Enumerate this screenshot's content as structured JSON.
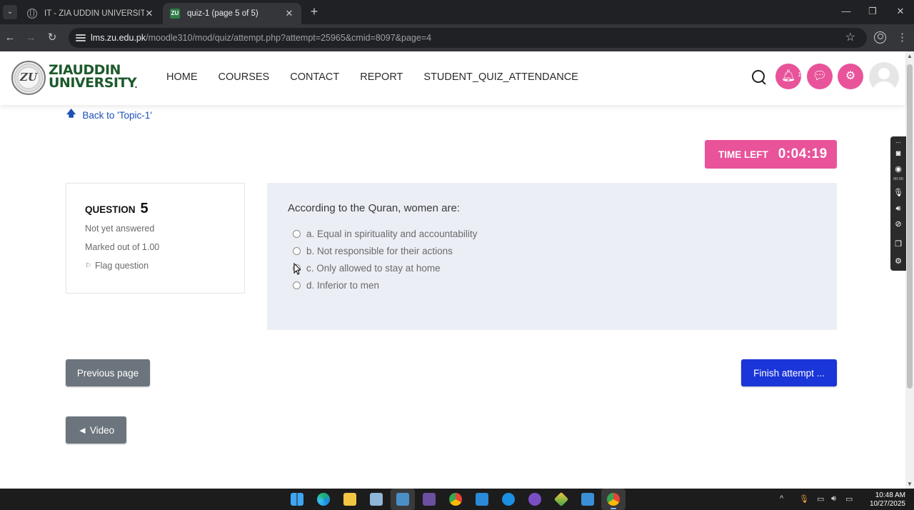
{
  "browser": {
    "tabs": [
      {
        "title": "IT - ZIA UDDIN UNIVERSITY",
        "favicon": "globe-icon",
        "active": false
      },
      {
        "title": "quiz-1 (page 5 of 5)",
        "favicon": "zu-favicon",
        "favicon_text": "ZU",
        "active": true
      }
    ],
    "url_host": "lms.zu.edu.pk",
    "url_path": "/moodle310/mod/quiz/attempt.php?attempt=25965&cmid=8097&page=4"
  },
  "header": {
    "logo_line1": "ZIAUDDIN",
    "logo_line2": "UNIVERSITY",
    "logo_dot": ".",
    "nav": [
      "HOME",
      "COURSES",
      "CONTACT",
      "REPORT",
      "STUDENT_QUIZ_ATTENDANCE"
    ],
    "notification_count": "1"
  },
  "page": {
    "back_link": "Back to 'Topic-1'",
    "timer_label": "TIME LEFT",
    "timer_value": "0:04:19"
  },
  "question": {
    "label": "QUESTION",
    "number": "5",
    "state": "Not yet answered",
    "grade": "Marked out of 1.00",
    "flag": "Flag question",
    "text": "According to the Quran, women are:",
    "answers": [
      "a. Equal in spirituality and accountability",
      "b. Not responsible for their actions",
      "c. Only allowed to stay at home",
      "d. Inferior to men"
    ]
  },
  "buttons": {
    "previous": "Previous page",
    "finish": "Finish attempt ...",
    "video": "◄ Video"
  },
  "toolstrip": {
    "time": "00:00"
  },
  "taskbar": {
    "time": "10:48 AM",
    "date": "10/27/2025"
  },
  "colors": {
    "brand_pink": "#e8539a",
    "primary_blue": "#1a35d8",
    "secondary_gray": "#6c757d",
    "logo_green": "#1d5a2c",
    "question_bg": "#eceef6"
  }
}
